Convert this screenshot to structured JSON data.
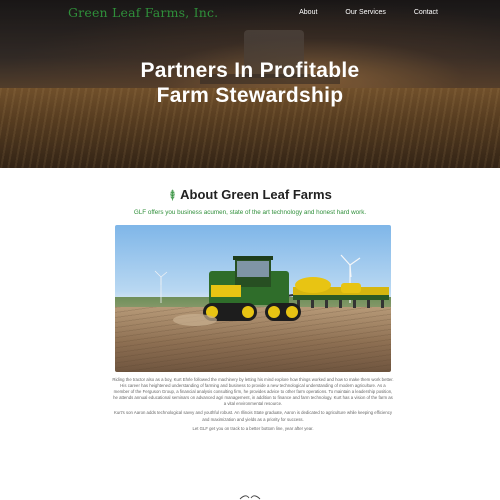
{
  "header": {
    "logo": "Green Leaf Farms, Inc.",
    "nav": [
      {
        "label": "About"
      },
      {
        "label": "Our Services"
      },
      {
        "label": "Contact"
      }
    ]
  },
  "hero": {
    "line1_regular": "Partners In ",
    "line1_bold": "Profitable",
    "line2_regular": "Farm ",
    "line2_bold": "Stewardship"
  },
  "about": {
    "icon": "leaf-icon",
    "title_regular": "About Green ",
    "title_bold": "Leaf Farms",
    "tagline": "GLF offers you business acumen, state of the art technology and honest hard work.",
    "image": "tractor-planting-field",
    "paragraphs": [
      "Riding the tractor also as a boy, Kurt Ehrle followed the machinery by letting his mind explore how things worked and how to make them work better. His career has heightened understanding of farming and business to provide a new technological understanding of modern agriculture. As a member of the Ferguson Group, a financial analysis consulting firm, he provides advice to other farm operations. To maintain a leadership position, he attends annual educational seminars on advanced agri management, in addition to finance and farm technology. Kurt has a vision of the farm as a vital environmental resource.",
      "Kurt's son Aaron adds technological savvy and youthful robust. An Illinois State graduate, Aaron is dedicated to agriculture while keeping efficiency and maximization and yields as a priority for success.",
      "Let GLF get you on track to a better bottom line, year after year."
    ]
  },
  "colors": {
    "brand_green": "#2f8f3a",
    "tractor_green": "#2f6d2a",
    "tractor_yellow": "#e8c413"
  }
}
